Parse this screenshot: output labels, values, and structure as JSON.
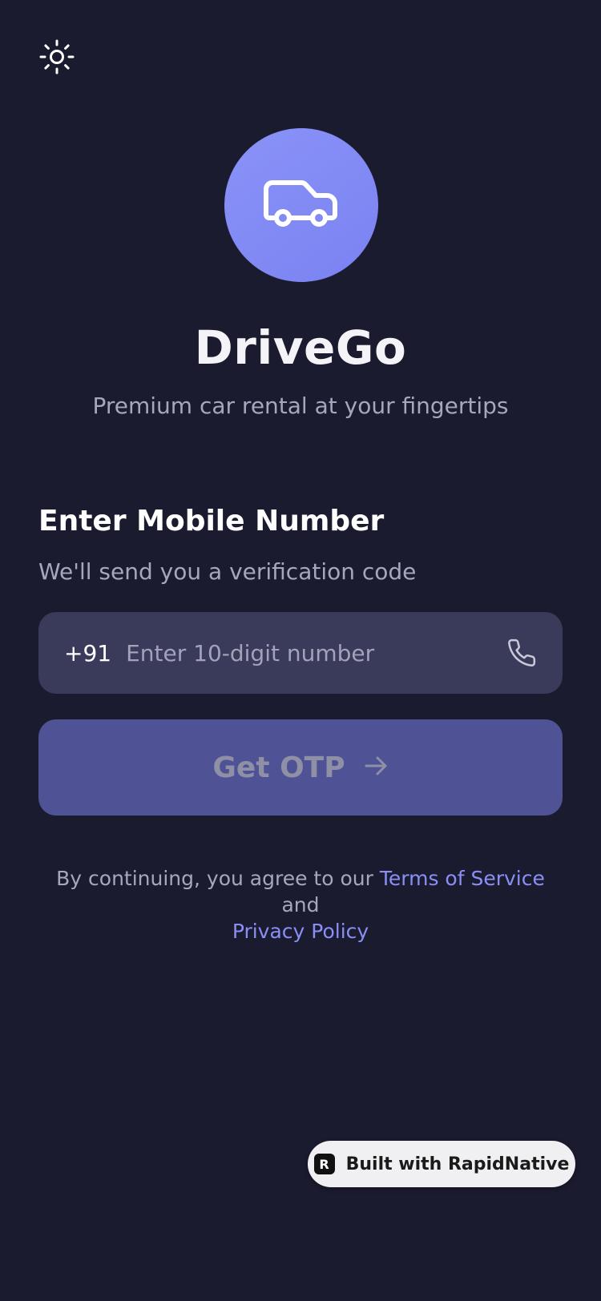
{
  "theme_toggle": {
    "icon": "sun-icon"
  },
  "logo": {
    "icon": "car-icon",
    "background": "#8088f4"
  },
  "app": {
    "title": "DriveGo",
    "subtitle": "Premium car rental at your fingertips"
  },
  "login": {
    "title": "Enter Mobile Number",
    "subtitle": "We'll send you a verification code",
    "country_code": "+91",
    "phone_value": "",
    "phone_placeholder": "Enter 10-digit number",
    "phone_icon": "phone-icon"
  },
  "otp_button": {
    "label": "Get OTP",
    "icon": "arrow-right-icon",
    "enabled": false
  },
  "terms": {
    "prefix": "By continuing, you agree to our",
    "terms_link": "Terms of Service",
    "conjunction": "and",
    "privacy_link": "Privacy Policy"
  },
  "badge": {
    "logo_letter": "R",
    "label": "Built with RapidNative"
  },
  "colors": {
    "background": "#1b1b2f",
    "accent": "#8088f4",
    "button_disabled": "#4f5396",
    "field_background": "#3a3a5a",
    "link": "#8a8ff5"
  }
}
